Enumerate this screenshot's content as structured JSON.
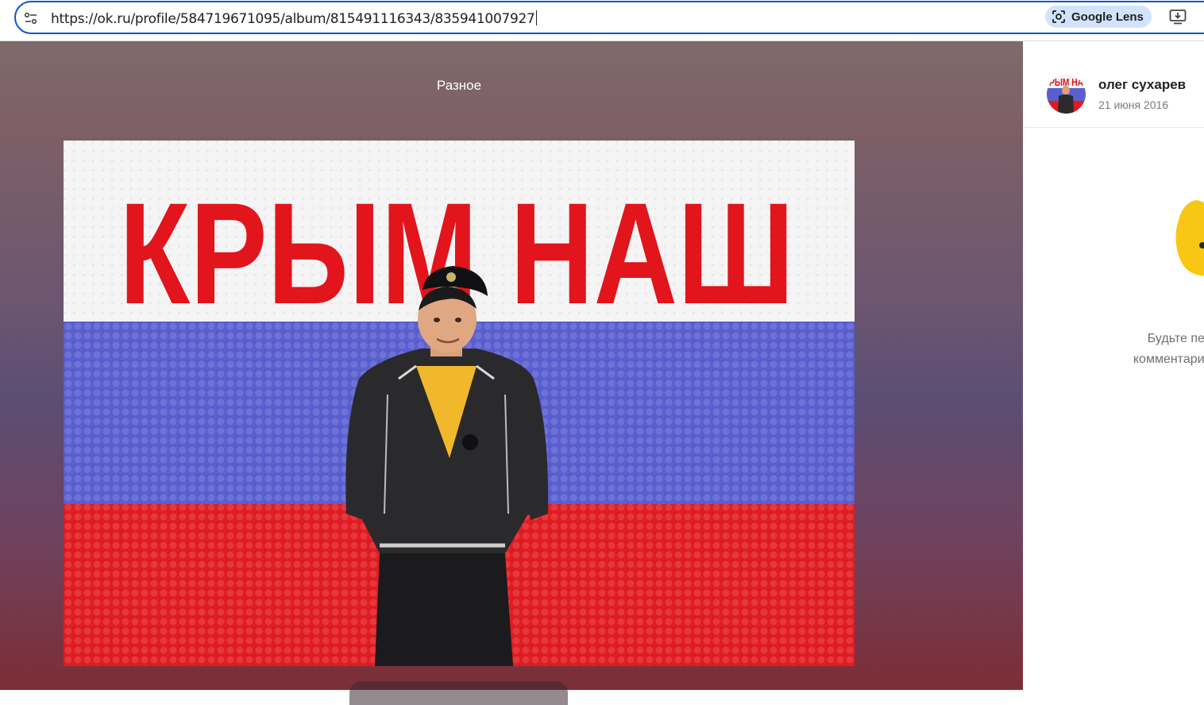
{
  "browser": {
    "url": "https://ok.ru/profile/584719671095/album/815491116343/835941007927",
    "lens_label": "Google Lens",
    "icons": [
      "tune-icon",
      "google-lens-icon",
      "install-app-icon"
    ]
  },
  "viewer": {
    "album_title": "Разное",
    "photo_text": "КРЫМ НАШ"
  },
  "sidebar": {
    "author_name": "олег сухарев",
    "post_date": "21 июня 2016",
    "avatar_text": "РЫМ НА",
    "empty_line1": "Будьте первым,",
    "empty_line2": "комментарий к фото"
  },
  "colors": {
    "accent": "#0b57d0",
    "lens_bg": "#d3e3fd",
    "flag_white": "#f4f4f4",
    "flag_blue": "#5a5fd0",
    "flag_red": "#e01c22"
  }
}
